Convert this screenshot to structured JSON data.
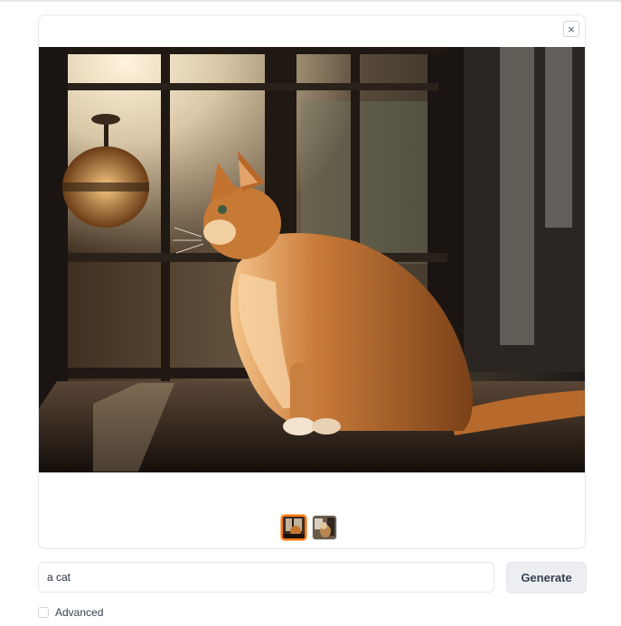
{
  "gallery": {
    "close_symbol": "×",
    "main_image_alt": "Orange tabby cat sitting on a windowsill in backlight",
    "thumbnails": [
      {
        "name": "cat-window-thumbnail",
        "selected": true
      },
      {
        "name": "cat-interior-thumbnail",
        "selected": false
      }
    ]
  },
  "prompt": {
    "value": "a cat"
  },
  "generate": {
    "label": "Generate"
  },
  "advanced": {
    "label": "Advanced",
    "checked": false
  },
  "colors": {
    "accent": "#f97316",
    "button_bg": "#eceef2",
    "border": "#e5e7eb"
  }
}
